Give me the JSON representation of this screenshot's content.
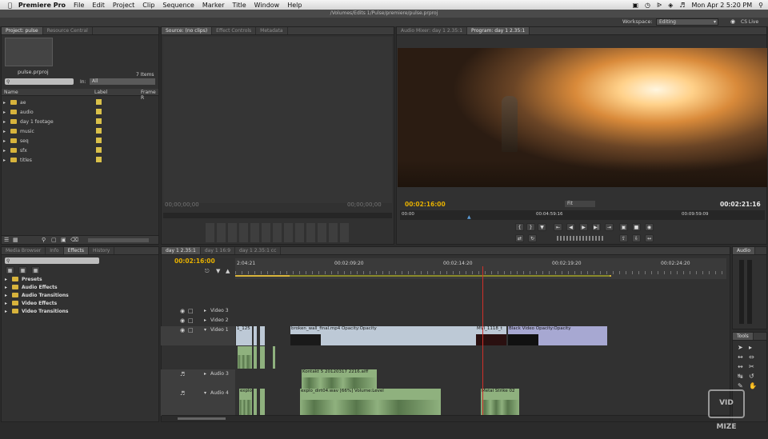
{
  "menubar": {
    "app": "Premiere Pro",
    "items": [
      "File",
      "Edit",
      "Project",
      "Clip",
      "Sequence",
      "Marker",
      "Title",
      "Window",
      "Help"
    ],
    "clock": "Mon Apr 2  5:20 PM"
  },
  "titlebar": {
    "path": "/Volumes/Edits 1/Pulse/premiere/pulse.prproj"
  },
  "workspace": {
    "label": "Workspace:",
    "value": "Editing",
    "cslive": "CS Live"
  },
  "project": {
    "tabs": [
      "Project: pulse",
      "Resource Central"
    ],
    "file": "pulse.prproj",
    "items_count": "7 Items",
    "in_label": "In:",
    "in_value": "All",
    "columns": [
      "Name",
      "Label",
      "Frame R"
    ],
    "bins": [
      "ae",
      "audio",
      "day 1 footage",
      "music",
      "seq",
      "sfx",
      "titles"
    ]
  },
  "source": {
    "tabs": [
      "Source: (no clips)",
      "Effect Controls",
      "Metadata"
    ],
    "tc_left": "00;00;00;00",
    "tc_right": "00;00;00;00"
  },
  "program": {
    "tabs": [
      "Audio Mixer: day 1 2.35:1",
      "Program: day 1 2.35:1"
    ],
    "tc_current": "00:02:16:00",
    "fit": "Fit",
    "tc_duration": "00:02:21:16",
    "ruler": [
      "00:00",
      "00:04:59:16",
      "00:09:59:09"
    ]
  },
  "effects": {
    "tabs": [
      "Media Browser",
      "Info",
      "Effects",
      "History"
    ],
    "folders": [
      "Presets",
      "Audio Effects",
      "Audio Transitions",
      "Video Effects",
      "Video Transitions"
    ]
  },
  "timeline": {
    "tabs": [
      "day 1 2.35:1",
      "day 1 16:9",
      "day 1 2.35:1 cc"
    ],
    "tc": "00:02:16:00",
    "ruler": [
      "2:04:21",
      "00:02:09:20",
      "00:02:14:20",
      "00:02:19:20",
      "00:02:24:20"
    ],
    "tracks": {
      "v3": "Video 3",
      "v2": "Video 2",
      "v1": "Video 1",
      "a3": "Audio 3",
      "a4": "Audio 4"
    },
    "clips": {
      "v1_a": "1_125",
      "v1_b": "broken_wall_final.mp4  Opacity:Opacity",
      "v1_c": "MVI_1118_t",
      "v1_d": "Black Video  Opacity:Opacity",
      "a3_a": "Kontakt 5 20120317 2216.aiff",
      "a4_a": "explo",
      "a4_b": "explo_dirt04.wav [66%]  Volume:Level",
      "a4_c": "Metal Strike 02"
    }
  },
  "audio_meters": {
    "tab": "Audio"
  },
  "tools": {
    "tab": "Tools"
  },
  "watermark": "VID MIZE",
  "colors": {
    "accent_yellow": "#e6b000",
    "video_clip": "#a7a8d2",
    "audio_clip": "#8fb17e",
    "playhead": "#d0302a"
  }
}
